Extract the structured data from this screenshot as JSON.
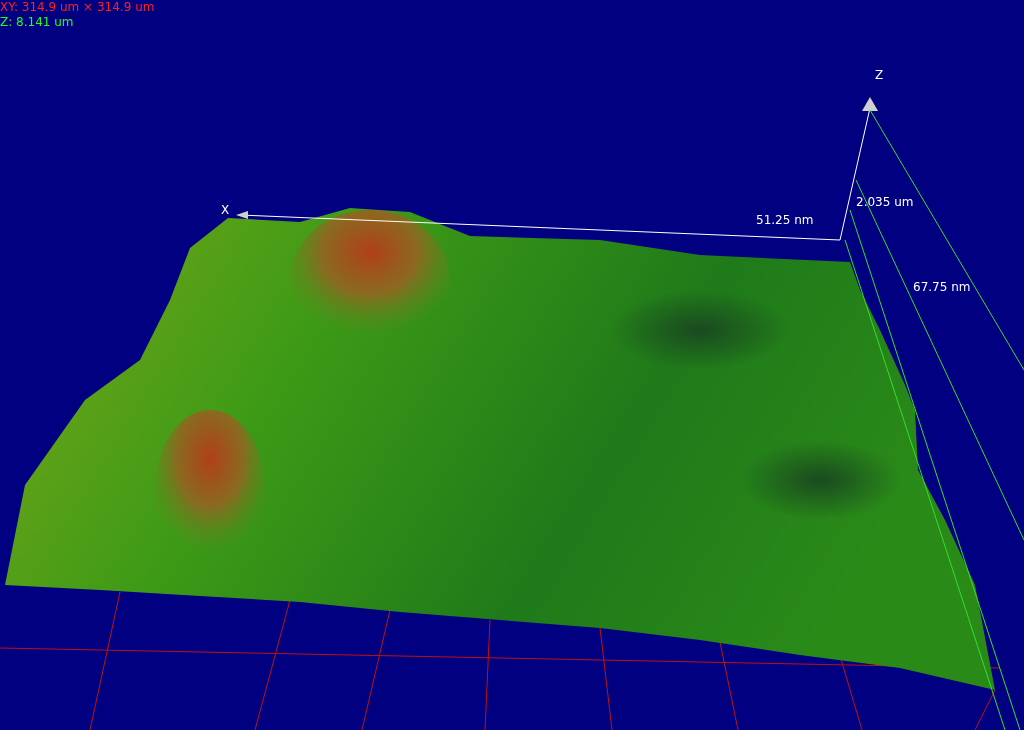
{
  "dimensions": {
    "xy": "XY: 314.9 um × 314.9 um",
    "z": "Z: 8.141 um"
  },
  "axes": {
    "x_label": "X",
    "z_label": "Z"
  },
  "scale_labels": [
    {
      "text": "51.25 nm",
      "color": "#ffffff"
    },
    {
      "text": "2.035 um",
      "color": "#ffffff"
    },
    {
      "text": "67.75 nm",
      "color": "#ffffff"
    }
  ]
}
